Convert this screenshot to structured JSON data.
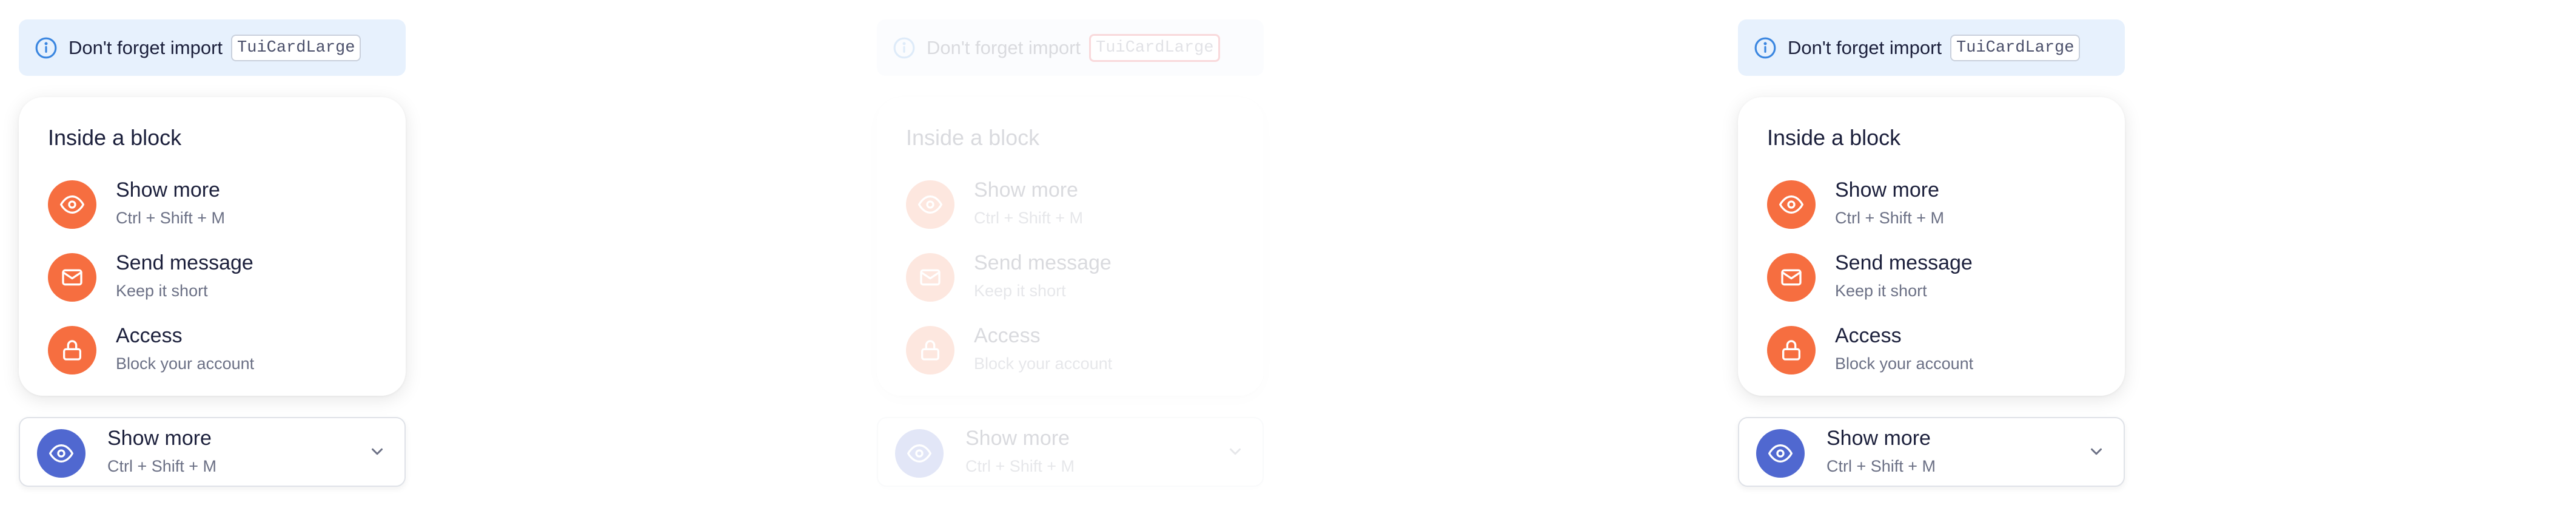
{
  "notice": {
    "text": "Don't forget import",
    "code": "TuiCardLarge"
  },
  "card": {
    "title": "Inside a block",
    "items": [
      {
        "title": "Show more",
        "subtitle": "Ctrl + Shift + M",
        "icon": "eye-icon"
      },
      {
        "title": "Send message",
        "subtitle": "Keep it short",
        "icon": "envelope-icon"
      },
      {
        "title": "Access",
        "subtitle": "Block your account",
        "icon": "lock-icon"
      }
    ]
  },
  "accordion": {
    "title": "Show more",
    "subtitle": "Ctrl + Shift + M",
    "icon": "eye-icon"
  },
  "colors": {
    "accent_orange": "#f66e40",
    "accent_blue": "#5068d0",
    "notice_bg": "#e7f1fd",
    "highlight_red": "#e01b24"
  }
}
